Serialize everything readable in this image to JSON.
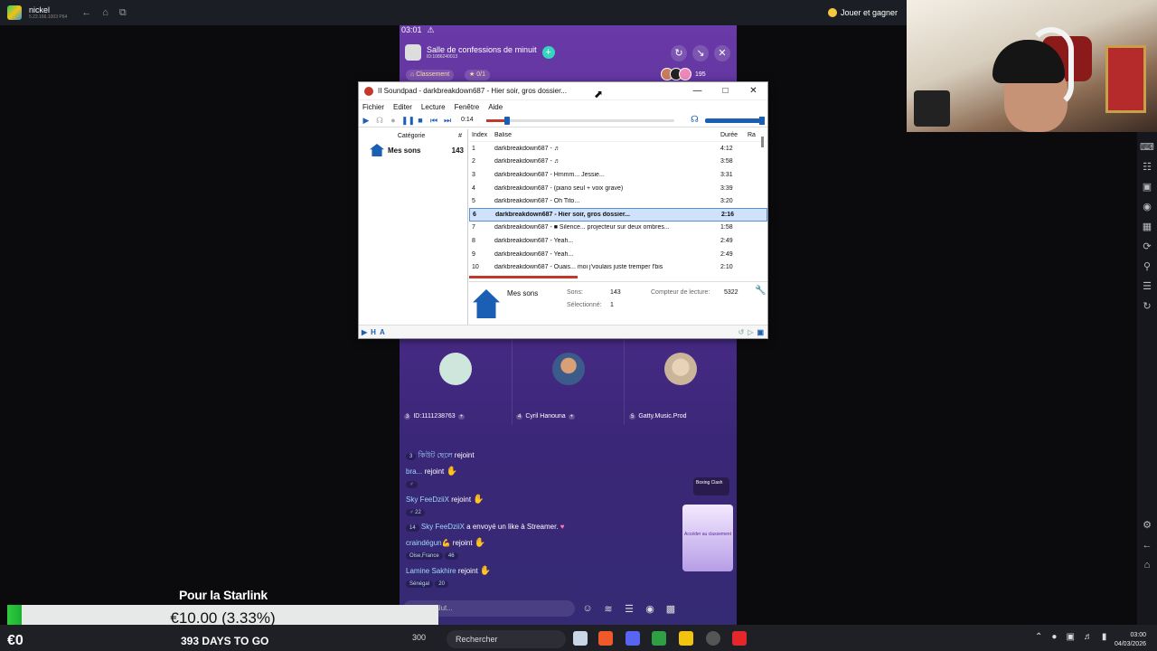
{
  "topbar": {
    "app_name": "nickel",
    "app_sub": "5.22.166.1003 P64",
    "play_label": "Jouer et gagner"
  },
  "phone": {
    "status_time": "03:01",
    "room_title": "Salle de confessions de minuit",
    "room_id": "ID:1086240013",
    "chip_ranking": "Classement",
    "chip_badge": "0/1",
    "viewer_count": "195",
    "seats": [
      {
        "num": "3",
        "name": "ID:1111238763"
      },
      {
        "num": "4",
        "name": "Cyril Hanouna"
      },
      {
        "num": "5",
        "name": "Gatty.Music.Prod"
      }
    ],
    "chat": [
      {
        "user": "কিউট ছেলে",
        "text": "rejoint",
        "level": "3"
      },
      {
        "user": "bra...",
        "text": "rejoint",
        "tag": "♂"
      },
      {
        "user": "Sky FeeDziiX",
        "text": "rejoint",
        "tag": "♂ 22"
      },
      {
        "user": "Sky FeeDziiX",
        "text": "a envoyé un like à Streamer.",
        "level": "14"
      },
      {
        "user": "craindégun💪",
        "text": "rejoint",
        "tag": "Oise,France",
        "tag2": "46"
      },
      {
        "user": "Lamine Sakhire",
        "text": "rejoint",
        "tag": "Sénégal",
        "tag2": "20"
      }
    ],
    "boxing_label": "Boxing Clash",
    "promo_text": "Accéder au classement",
    "input_placeholder": "Salut..."
  },
  "soundpad": {
    "title": "Soundpad - darkbreakdown687 - Hier soir, gros dossier...",
    "menu": [
      "Fichier",
      "Editer",
      "Lecture",
      "Fenêtre",
      "Aide"
    ],
    "position": "0:14",
    "seek_fraction": 0.11,
    "category_header": "Catégorie",
    "count_header": "#",
    "category_name": "Mes sons",
    "category_count": "143",
    "col_index": "Index",
    "col_tag": "Balise",
    "col_duration": "Durée",
    "col_rating": "Ra",
    "rows": [
      {
        "i": "1",
        "t": "darkbreakdown687 - ♬",
        "d": "4:12"
      },
      {
        "i": "2",
        "t": "darkbreakdown687 - ♬",
        "d": "3:58"
      },
      {
        "i": "3",
        "t": "darkbreakdown687 - Hmmm... Jessie...",
        "d": "3:31"
      },
      {
        "i": "4",
        "t": "darkbreakdown687 - (piano seul + voix grave)",
        "d": "3:39"
      },
      {
        "i": "5",
        "t": "darkbreakdown687 - Oh Tito...",
        "d": "3:20"
      },
      {
        "i": "6",
        "t": "darkbreakdown687 - Hier soir, gros dossier...",
        "d": "2:16",
        "selected": true
      },
      {
        "i": "7",
        "t": "darkbreakdown687 - ■ Silence... projecteur sur deux ombres...",
        "d": "1:58"
      },
      {
        "i": "8",
        "t": "darkbreakdown687 - Yeah...",
        "d": "2:49"
      },
      {
        "i": "9",
        "t": "darkbreakdown687 - Yeah...",
        "d": "2:49"
      },
      {
        "i": "10",
        "t": "darkbreakdown687 - Ouais... moi j'voulais juste tremper l'bis",
        "d": "2:10"
      }
    ],
    "info_name": "Mes sons",
    "info_sounds_label": "Sons:",
    "info_sounds": "143",
    "info_selected_label": "Sélectionné:",
    "info_selected": "1",
    "info_counter_label": "Compteur de lecture:",
    "info_counter": "5322"
  },
  "overlay": {
    "title": "Pour la Starlink",
    "amount": "€10.00 (3.33%)",
    "progress_fraction": 0.0333,
    "start": "€0",
    "days": "393 DAYS TO GO"
  },
  "taskbar": {
    "search": "Rechercher",
    "time": "03:00",
    "date": "04/03/2026",
    "left_label": "300"
  }
}
